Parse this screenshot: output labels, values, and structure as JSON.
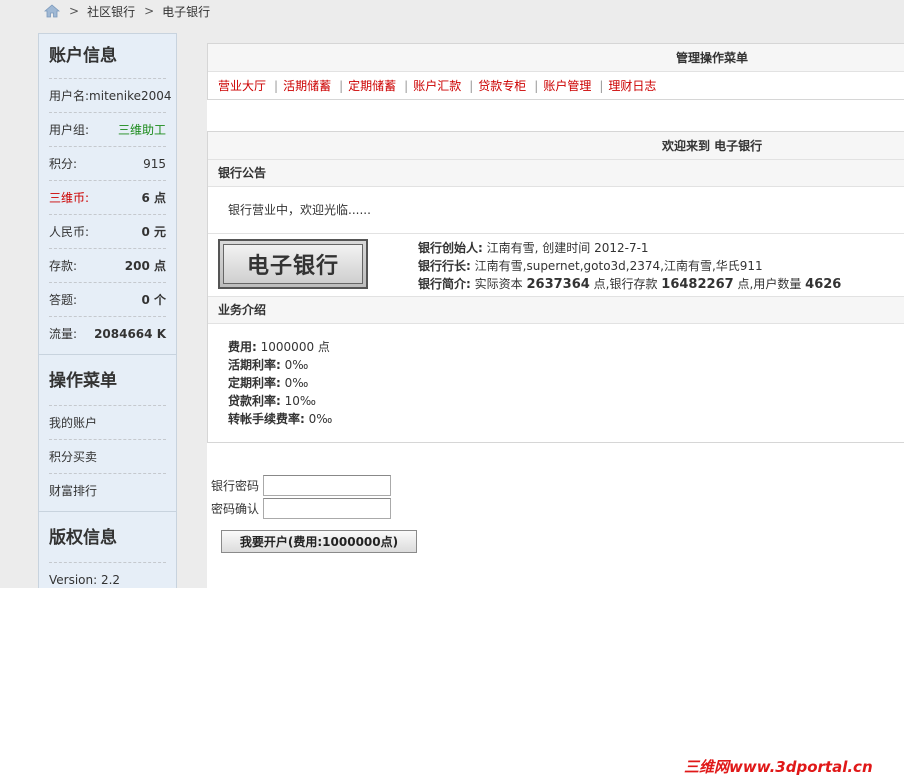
{
  "breadcrumb": {
    "items": [
      "社区银行",
      "电子银行"
    ],
    "separator": ">"
  },
  "sidebar": {
    "account_title": "账户信息",
    "account_rows": [
      {
        "label": "用户名:",
        "value": "mitenike2004"
      },
      {
        "label": "用户组:",
        "value": "三维助工"
      },
      {
        "label": "积分:",
        "value": "915"
      },
      {
        "label": "三维币:",
        "value": "6 点"
      },
      {
        "label": "人民币:",
        "value": "0 元"
      },
      {
        "label": "存款:",
        "value": "200 点"
      },
      {
        "label": "答题:",
        "value": "0 个"
      },
      {
        "label": "流量:",
        "value": "2084664 K"
      }
    ],
    "menu_title": "操作菜单",
    "menu_items": [
      "我的账户",
      "积分买卖",
      "财富排行"
    ],
    "copyright_title": "版权信息",
    "version": "Version: 2.2"
  },
  "main": {
    "menu_panel_title": "管理操作菜单",
    "menu_links": [
      "营业大厅",
      "活期储蓄",
      "定期储蓄",
      "账户汇款",
      "贷款专柜",
      "账户管理",
      "理财日志"
    ],
    "menu_separator": "|",
    "welcome_title": "欢迎来到 电子银行",
    "notice_title": "银行公告",
    "notice_text": "银行营业中，欢迎光临......",
    "logo_text": "电子银行",
    "bank_info": {
      "founder_label": "银行创始人:",
      "founder_text": "江南有雪, 创建时间 2012-7-1",
      "president_label": "银行行长:",
      "president_text": "江南有雪,supernet,goto3d,2374,江南有雪,华氏911",
      "intro_label": "银行简介:",
      "intro_text1": "实际资本",
      "capital": "2637364",
      "intro_text2": "点,银行存款",
      "deposits": "16482267",
      "intro_text3": "点,用户数量",
      "users": "4626"
    },
    "biz_title": "业务介绍",
    "biz_rows": [
      {
        "label": "费用:",
        "value": "1000000 点"
      },
      {
        "label": "活期利率:",
        "value": "0‰"
      },
      {
        "label": "定期利率:",
        "value": "0‰"
      },
      {
        "label": "贷款利率:",
        "value": "10‰"
      },
      {
        "label": "转帐手续费率:",
        "value": "0‰"
      }
    ]
  },
  "form": {
    "password_label": "银行密码",
    "password_value": "",
    "confirm_label": "密码确认",
    "confirm_value": "",
    "submit_label": "我要开户(费用:1000000点)"
  },
  "watermark": "三维网www.3dportal.cn",
  "colors": {
    "link_red": "#cc0000",
    "group_green": "#1a8a1a",
    "sidebar_bg": "#e6eef7",
    "watermark_red": "#e01818"
  },
  "icons": {
    "home": "home-icon"
  }
}
